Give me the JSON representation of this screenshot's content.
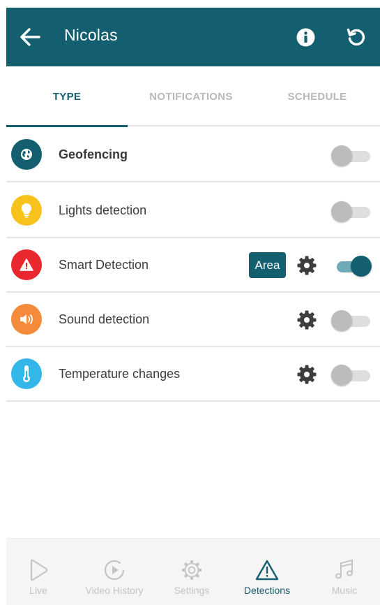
{
  "header": {
    "title": "Nicolas",
    "icons": [
      "back-arrow-icon",
      "info-icon",
      "refresh-icon"
    ],
    "background_color": "#135f70"
  },
  "tabs": [
    {
      "label": "TYPE",
      "active": true
    },
    {
      "label": "NOTIFICATIONS",
      "active": false
    },
    {
      "label": "SCHEDULE",
      "active": false
    }
  ],
  "detections": [
    {
      "label": "Geofencing",
      "icon": "globe-icon",
      "icon_color": "#135f70",
      "enabled": false,
      "has_settings": false,
      "has_area": false
    },
    {
      "label": "Lights detection",
      "icon": "lightbulb-icon",
      "icon_color": "#f6c21b",
      "enabled": false,
      "has_settings": false,
      "has_area": false
    },
    {
      "label": "Smart Detection",
      "icon": "warning-icon",
      "icon_color": "#e8282e",
      "enabled": true,
      "has_settings": true,
      "has_area": true,
      "area_label": "Area"
    },
    {
      "label": "Sound detection",
      "icon": "speaker-icon",
      "icon_color": "#f38a3c",
      "enabled": false,
      "has_settings": true,
      "has_area": false
    },
    {
      "label": "Temperature changes",
      "icon": "thermometer-icon",
      "icon_color": "#33b6e8",
      "enabled": false,
      "has_settings": true,
      "has_area": false
    }
  ],
  "bottom_nav": [
    {
      "label": "Live",
      "icon": "play-icon",
      "active": false
    },
    {
      "label": "Video History",
      "icon": "video-history-icon",
      "active": false
    },
    {
      "label": "Settings",
      "icon": "gear-icon",
      "active": false
    },
    {
      "label": "Detections",
      "icon": "warning-icon",
      "active": true
    },
    {
      "label": "Music",
      "icon": "music-note-icon",
      "active": false
    }
  ],
  "colors": {
    "accent": "#135f70",
    "inactive_text": "#b8b8b8",
    "divider": "#e6e6e6"
  }
}
